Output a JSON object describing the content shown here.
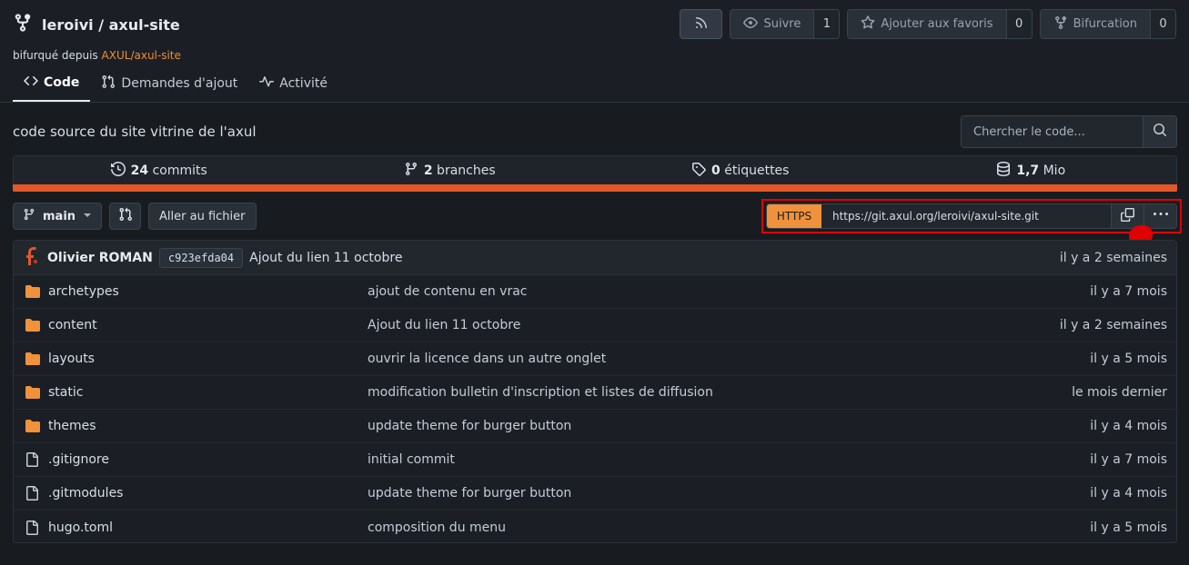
{
  "header": {
    "owner": "leroivi",
    "separator": " / ",
    "repo": "axul-site",
    "fork_prefix": "bifurqué depuis ",
    "fork_source": "AXUL/axul-site",
    "watch_label": "Suivre",
    "watch_count": "1",
    "star_label": "Ajouter aux favoris",
    "star_count": "0",
    "fork_label": "Bifurcation",
    "fork_count": "0"
  },
  "tabs": [
    {
      "label": "Code",
      "icon": "code-icon"
    },
    {
      "label": "Demandes d'ajout",
      "icon": "pull-request-icon"
    },
    {
      "label": "Activité",
      "icon": "pulse-icon"
    }
  ],
  "description": "code source du site vitrine de l'axul",
  "search": {
    "placeholder": "Chercher le code..."
  },
  "stats": [
    {
      "icon": "history-icon",
      "value": "24",
      "label": " commits"
    },
    {
      "icon": "branch-icon",
      "value": "2",
      "label": " branches"
    },
    {
      "icon": "tag-icon",
      "value": "0",
      "label": " étiquettes"
    },
    {
      "icon": "database-icon",
      "value": "1,7",
      "label": " Mio"
    }
  ],
  "colors": {
    "accent": "#f0923b",
    "language_bar": "#e3572b",
    "highlight": "#e00000",
    "folder": "#f0923b"
  },
  "branch": {
    "name": "main",
    "goto_label": "Aller au fichier"
  },
  "clone": {
    "protocol": "HTTPS",
    "url": "https://git.axul.org/leroivi/axul-site.git"
  },
  "latest_commit": {
    "author": "Olivier ROMAN",
    "sha": "c923efda04",
    "message": "Ajout du lien 11 octobre",
    "time": "il y a 2 semaines"
  },
  "files": [
    {
      "type": "folder",
      "name": "archetypes",
      "message": "ajout de contenu en vrac",
      "time": "il y a 7 mois"
    },
    {
      "type": "folder",
      "name": "content",
      "message": "Ajout du lien 11 octobre",
      "time": "il y a 2 semaines"
    },
    {
      "type": "folder",
      "name": "layouts",
      "message": "ouvrir la licence dans un autre onglet",
      "time": "il y a 5 mois"
    },
    {
      "type": "folder",
      "name": "static",
      "message": "modification bulletin d'inscription et listes de diffusion",
      "time": "le mois dernier"
    },
    {
      "type": "folder",
      "name": "themes",
      "message": "update theme for burger button",
      "time": "il y a 4 mois"
    },
    {
      "type": "file",
      "name": ".gitignore",
      "message": "initial commit",
      "time": "il y a 7 mois"
    },
    {
      "type": "file",
      "name": ".gitmodules",
      "message": "update theme for burger button",
      "time": "il y a 4 mois"
    },
    {
      "type": "file",
      "name": "hugo.toml",
      "message": "composition du menu",
      "time": "il y a 5 mois"
    }
  ]
}
